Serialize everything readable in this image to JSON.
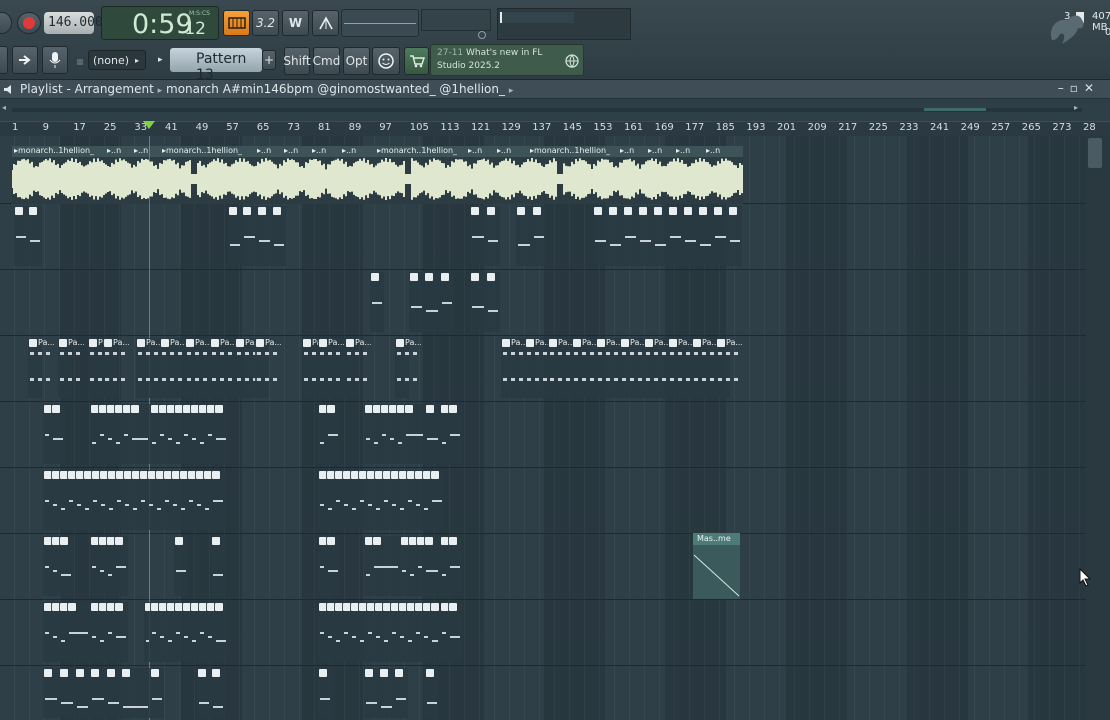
{
  "toolbar": {
    "tempo": "146.000",
    "time": "0:59",
    "time_sub": "12",
    "time_unit": "M:S:CS",
    "snap_label": "3.2",
    "voices": "3",
    "memory": "4078 MB",
    "cpu_zero": "0",
    "pattern_none": "(none)",
    "pattern": "Pattern 13",
    "plus": "+",
    "shift": "Shift",
    "cmd": "Cmd",
    "opt": "Opt",
    "news_date": "27-11",
    "news_line1": "What's new in FL",
    "news_line2": "Studio 2025.2"
  },
  "playlist": {
    "title": "Playlist - Arrangement",
    "separator": "▸",
    "project": "monarch A#min146bpm @ginomostwanted_ @1hellion_",
    "audio_clip_label": "monarch..1hellion_",
    "short_clip_label": "..n",
    "pattern_clip_label": "Pa...",
    "automation_label": "Mas..me"
  },
  "ruler": {
    "bars": [
      "1",
      "9",
      "17",
      "25",
      "33",
      "41",
      "49",
      "57",
      "65",
      "73",
      "81",
      "89",
      "97",
      "105",
      "113",
      "121",
      "129",
      "137",
      "145",
      "153",
      "161",
      "169",
      "177",
      "185",
      "193",
      "201",
      "209",
      "217",
      "225",
      "233",
      "241",
      "249",
      "257",
      "265",
      "273",
      "28"
    ]
  },
  "icons": [
    "record-icon",
    "play-icon",
    "arrow-right-icon",
    "mic-icon",
    "cart-icon",
    "globe-icon",
    "fl-logo-icon",
    "close-icon",
    "maximize-icon",
    "minimize-icon",
    "cursor-icon"
  ]
}
